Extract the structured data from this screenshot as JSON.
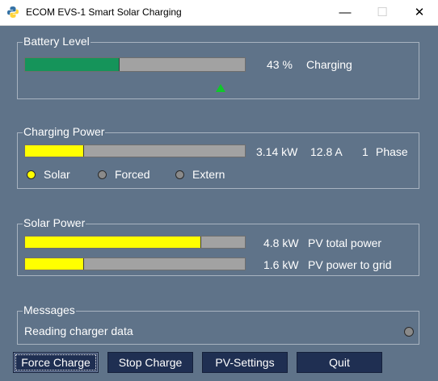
{
  "window": {
    "title": "ECOM EVS-1 Smart Solar Charging",
    "min_glyph": "—",
    "max_glyph": "☐",
    "close_glyph": "✕"
  },
  "battery": {
    "label": "Battery Level",
    "percent_text": "43 %",
    "status": "Charging",
    "fill": 0.43,
    "fill_color": "#15945a"
  },
  "charging_power": {
    "label": "Charging Power",
    "fill": 0.27,
    "fill_color": "#ffff00",
    "power": "3.14 kW",
    "current": "12.8 A",
    "phase_count": "1",
    "phase_label": "Phase",
    "modes": [
      {
        "label": "Solar",
        "active": true,
        "color": "#ffff00"
      },
      {
        "label": "Forced",
        "active": false,
        "color": "#8a8a8a"
      },
      {
        "label": "Extern",
        "active": false,
        "color": "#8a8a8a"
      }
    ]
  },
  "solar_power": {
    "label": "Solar Power",
    "rows": [
      {
        "value": "4.8 kW",
        "label": "PV total power",
        "fill": 0.8,
        "fill_color": "#ffff00"
      },
      {
        "value": "1.6 kW",
        "label": "PV power to grid",
        "fill": 0.27,
        "fill_color": "#ffff00"
      }
    ]
  },
  "messages": {
    "label": "Messages",
    "text": "Reading charger data",
    "indicator_color": "#8a8a8a"
  },
  "buttons": {
    "force_charge": "Force Charge",
    "stop_charge": "Stop Charge",
    "pv_settings": "PV-Settings",
    "quit": "Quit"
  }
}
